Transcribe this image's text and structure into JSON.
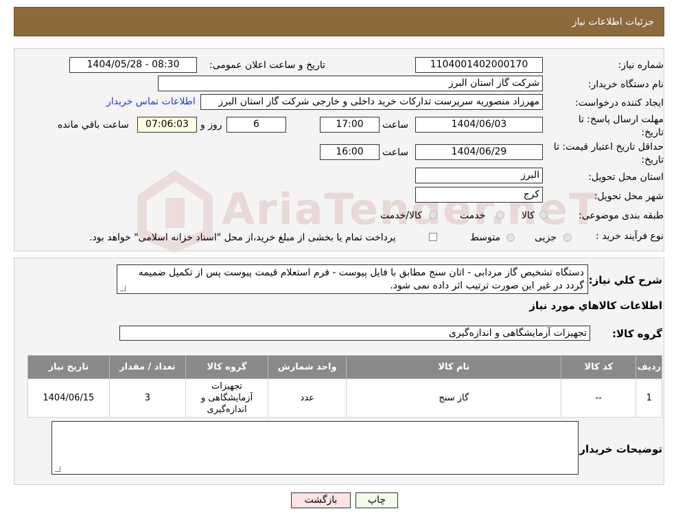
{
  "header": {
    "title": "جزئیات اطلاعات نیاز"
  },
  "form": {
    "need_number_label": "شماره نیاز:",
    "need_number": "1104001402000170",
    "announce_label": "تاریخ و ساعت اعلان عمومی:",
    "announce_value": "1404/05/28 - 08:30",
    "buyer_org_label": "نام دستگاه خریدار:",
    "buyer_org": "شرکت گاز استان البرز",
    "creator_label": "ایجاد کننده درخواست:",
    "creator": "مهرزاد منصوریه سرپرست تدارکات خرید داخلی و خارجی شرکت گاز استان البرز",
    "contact_link": "اطلاعات تماس خریدار",
    "deadline_label_1": "مهلت ارسال پاسخ: تا",
    "deadline_label_2": "تاریخ:",
    "deadline_date": "1404/06/03",
    "time_label": "ساعت",
    "deadline_time": "17:00",
    "days_value": "6",
    "days_label": "روز و",
    "remaining_time": "07:06:03",
    "remaining_label": "ساعت باقي مانده",
    "validity_label_1": "حداقل تاریخ اعتبار قیمت: تا",
    "validity_label_2": "تاریخ:",
    "validity_date": "1404/06/29",
    "validity_time": "16:00",
    "province_label": "استان محل تحویل:",
    "province": "البرز",
    "city_label": "شهر محل تحویل:",
    "city": "کرج",
    "category_label": "طبقه بندی موضوعی:",
    "category_options": [
      "کالا",
      "خدمت",
      "کالا/خدمت"
    ],
    "process_label": "نوع فرآیند خرید :",
    "process_options": [
      "جزیی",
      "متوسط"
    ],
    "process_note": "پرداخت تمام یا بخشی از مبلغ خرید،از محل \"اسناد خزانه اسلامی\" خواهد بود."
  },
  "watermark": "AriaTender.neT",
  "description": {
    "label": "شرح کلي نياز:",
    "text": "دستگاه تشخیص گاز مردابی - اتان سنج مطابق با فایل پیوست - فرم استعلام قیمت پیوست پس از تکمیل ضمیمه گردد در غیر این صورت ترتیب اثر داده نمی شود."
  },
  "goods": {
    "section_title": "اطلاعات کالاهاي مورد نياز",
    "group_label": "گروه کالا:",
    "group_value": "تجهیزات آزمایشگاهی و اندازه‌گیری",
    "columns": [
      "رديف",
      "کد کالا",
      "نام کالا",
      "واحد شمارش",
      "گروه کالا",
      "تعداد / مقدار",
      "تاريخ نياز"
    ],
    "rows": [
      {
        "row": "1",
        "code": "--",
        "name": "گاز سنج",
        "unit": "عدد",
        "group": "تجهیزات آزمایشگاهی و اندازه‌گیری",
        "qty": "3",
        "date": "1404/06/15"
      }
    ]
  },
  "buyer_notes": {
    "label": "توضیحات خریدار:",
    "value": ""
  },
  "buttons": {
    "print": "چاپ",
    "back": "بازگشت"
  }
}
